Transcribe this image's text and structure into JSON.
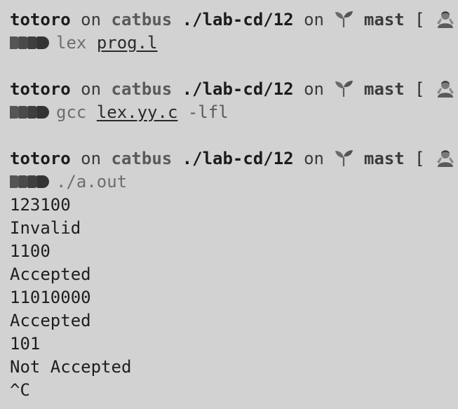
{
  "prompt": {
    "user": "totoro",
    "on1": "on",
    "host": "catbus",
    "path": "./lab-cd/12",
    "on2": "on",
    "branch": "mast",
    "bracket_open": "[",
    "bracket_close": "]",
    "branch_icon": "sprout-icon",
    "status_icon": "person-gesturing-icon",
    "input_icon": "arrows-prompt-icon"
  },
  "commands": [
    {
      "cmd": "lex",
      "arg": "prog.l",
      "flag": ""
    },
    {
      "cmd": "gcc",
      "arg": "lex.yy.c",
      "flag": "-lfl"
    },
    {
      "cmd": "./a.out",
      "arg": "",
      "flag": ""
    }
  ],
  "output": [
    "123100",
    "Invalid",
    "1100",
    "Accepted",
    "11010000",
    "Accepted",
    "101",
    "Not Accepted",
    "^C"
  ],
  "colors": {
    "background": "#d2d2d2",
    "text": "#1e1e1e",
    "muted": "#6e6e6e"
  }
}
